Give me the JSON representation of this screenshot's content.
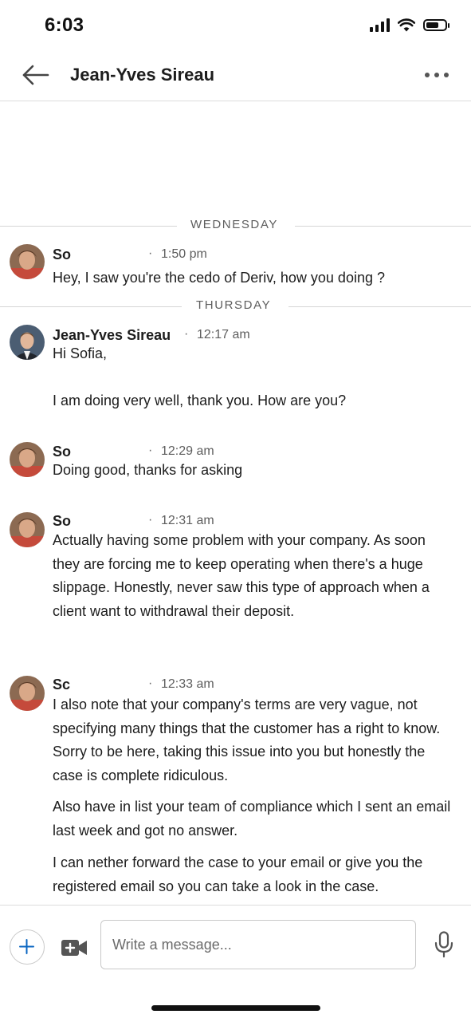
{
  "status_bar": {
    "time": "6:03",
    "battery_level": 0.7
  },
  "header": {
    "title": "Jean-Yves Sireau",
    "back_icon": "arrow-left-icon",
    "more_icon": "more-horizontal-icon"
  },
  "days": [
    {
      "label": "WEDNESDAY"
    },
    {
      "label": "THURSDAY"
    }
  ],
  "messages": [
    {
      "sender": "So",
      "dot": "·",
      "time": "1:50 pm",
      "text": "Hey, I saw you're the cedo of Deriv, how you doing ?"
    },
    {
      "sender": "Jean-Yves Sireau",
      "dot": "·",
      "time": "12:17 am",
      "text": "Hi Sofia,\n\nI am doing very well, thank you. How are you?"
    },
    {
      "sender": "So",
      "dot": "·",
      "time": "12:29 am",
      "text": "Doing good, thanks for asking"
    },
    {
      "sender": "So",
      "dot": "·",
      "time": "12:31 am",
      "text": "Actually having some problem with your company. As soon they are forcing me to keep operating when there's a huge slippage. Honestly, never saw this type of approach when a client want to withdrawal their deposit."
    },
    {
      "sender": "Sc",
      "dot": "·",
      "time": "12:33 am",
      "text": "I also note that your company's terms are very vague, not specifying many things that the customer has a right to know. Sorry to be here, taking this issue into you but honestly the case is complete ridiculous.",
      "text2": "Also have in list your team of compliance which I sent an email last week and got no answer.",
      "text3": " I can nether forward the case to your email or give you the registered email so you can take a look in the case."
    }
  ],
  "composer": {
    "placeholder": "Write a message...",
    "add_icon": "plus-icon",
    "video_icon": "video-plus-icon",
    "mic_icon": "microphone-icon"
  },
  "colors": {
    "text": "#1d1d1d",
    "muted": "#5e5e5e",
    "divider": "#d6d6d6",
    "accent": "#0a66c2"
  }
}
